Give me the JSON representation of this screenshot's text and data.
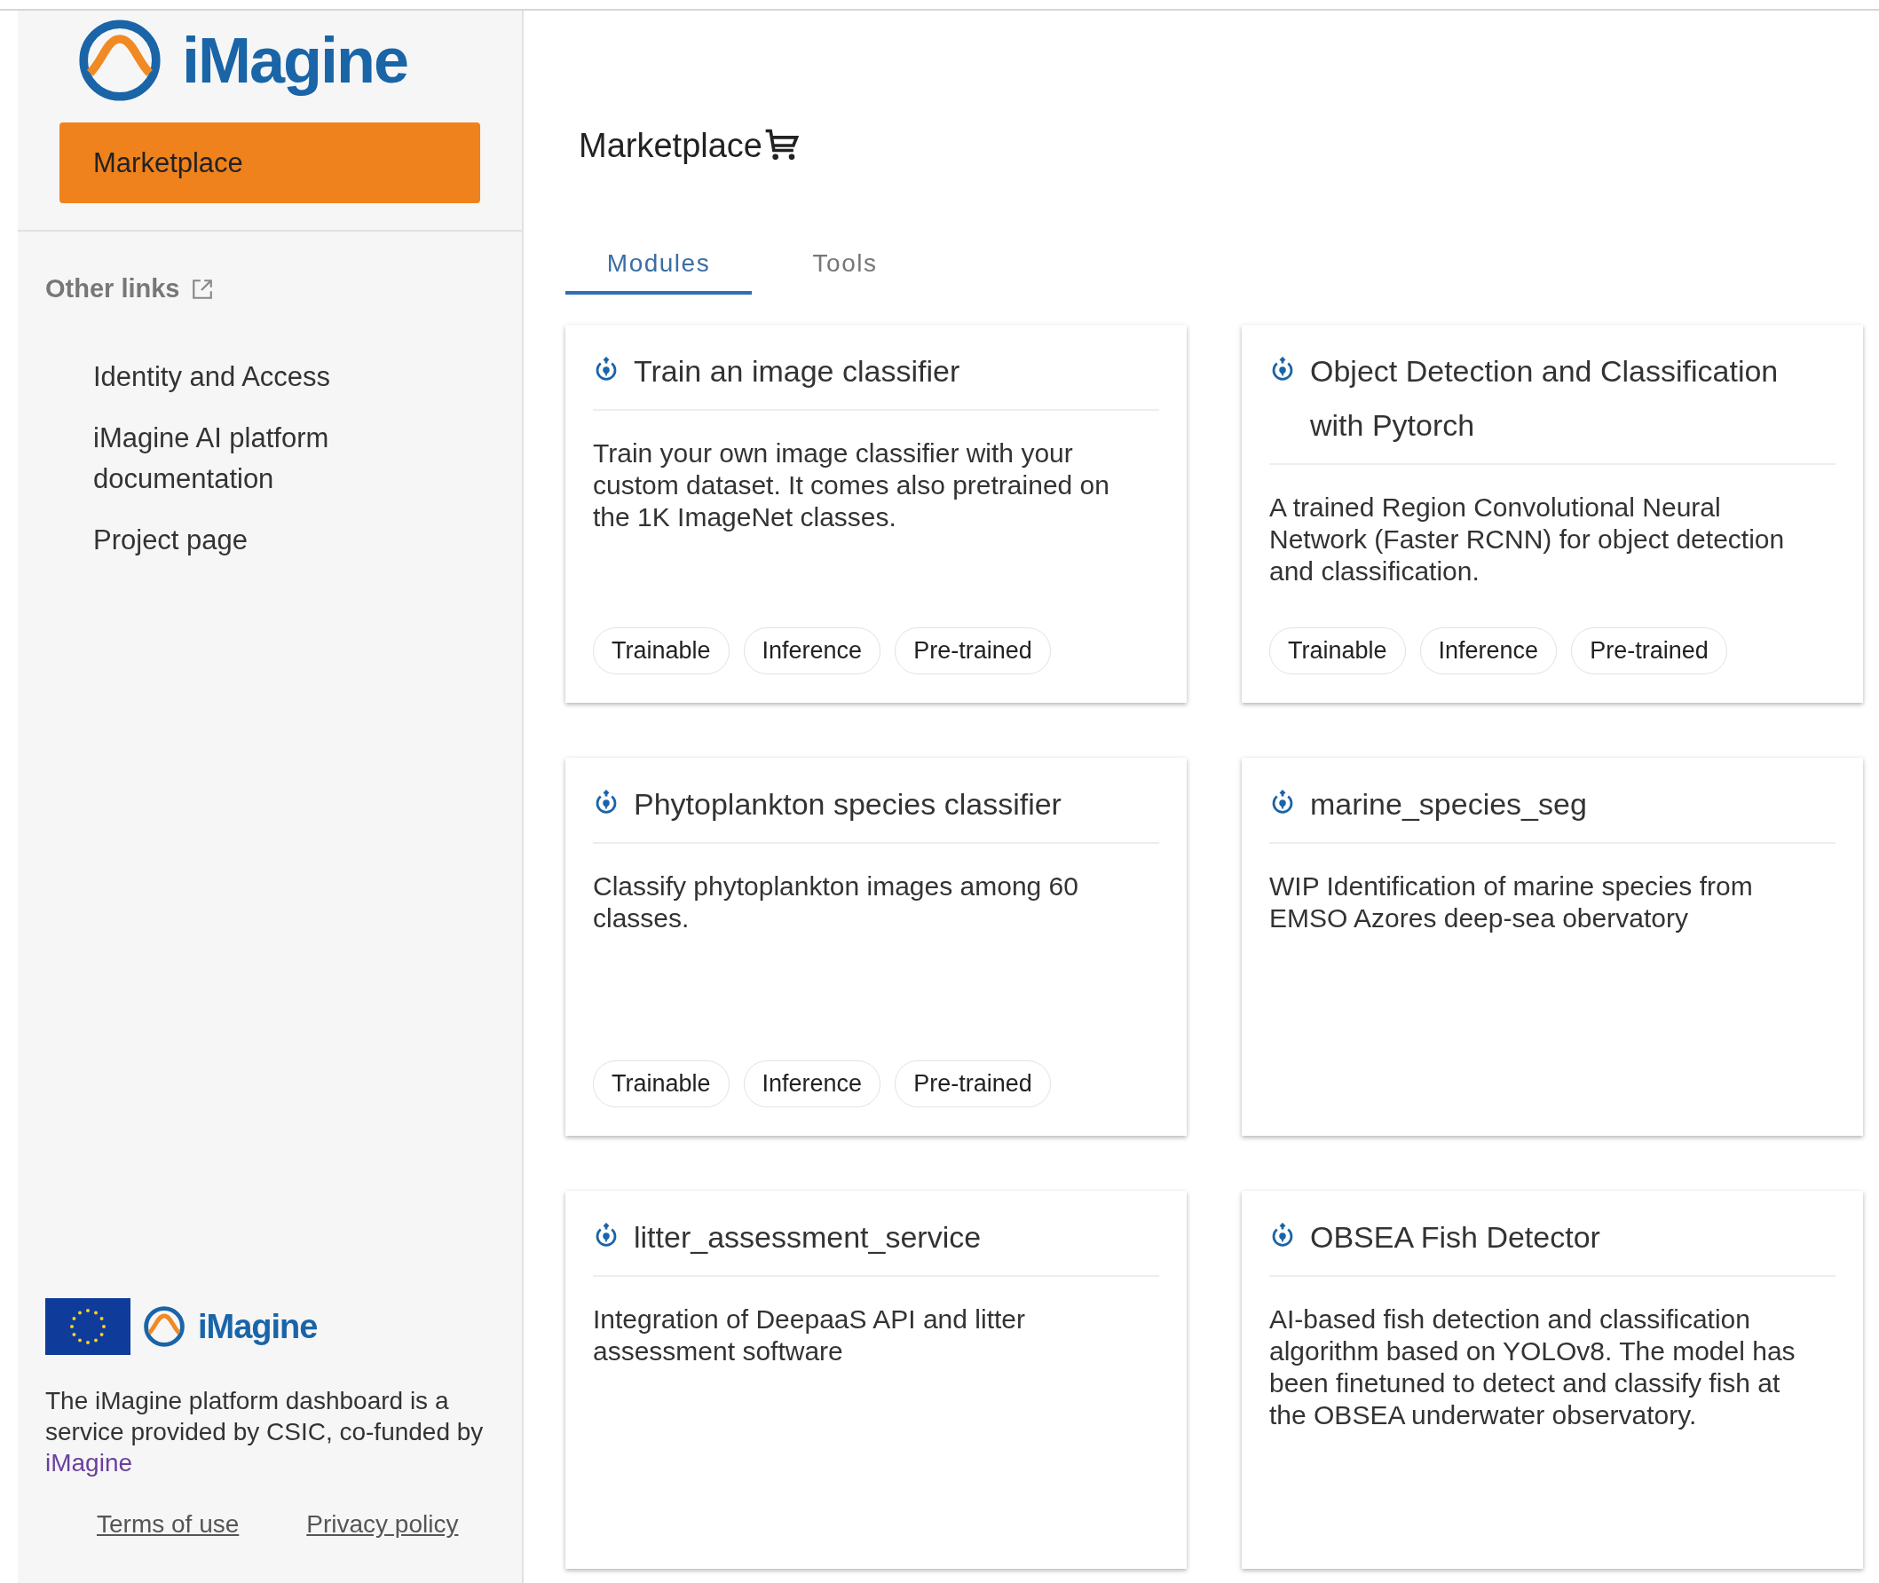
{
  "sidebar": {
    "logo": {
      "text": "iMagine"
    },
    "nav": [
      {
        "label": "Marketplace",
        "selected": true
      }
    ],
    "other_links": {
      "title": "Other links",
      "items": [
        "Identity and Access",
        "iMagine AI platform documentation",
        "Project page"
      ]
    },
    "footer": {
      "logo": {
        "text": "iMagine"
      },
      "text_before": "The iMagine platform dashboard is a service provided by CSIC, co-funded by",
      "link": "iMagine",
      "links": [
        "Terms of use",
        "Privacy policy"
      ]
    }
  },
  "main": {
    "title": "Marketplace",
    "tabs": [
      {
        "label": "Modules",
        "selected": true
      },
      {
        "label": "Tools",
        "selected": false
      }
    ],
    "cards": [
      {
        "title": "Train an image classifier",
        "description": "Train your own image classifier with your custom dataset. It comes also pretrained on the 1K ImageNet classes.",
        "tags": [
          "Trainable",
          "Inference",
          "Pre-trained"
        ]
      },
      {
        "title": "Object Detection and Classification with Pytorch",
        "description": "A trained Region Convolutional Neural Network (Faster RCNN) for object detection and classification.",
        "tags": [
          "Trainable",
          "Inference",
          "Pre-trained"
        ]
      },
      {
        "title": "Phytoplankton species classifier",
        "description": "Classify phytoplankton images among 60 classes.",
        "tags": [
          "Trainable",
          "Inference",
          "Pre-trained"
        ]
      },
      {
        "title": "marine_species_seg",
        "description": "WIP Identification of marine species from EMSO Azores deep-sea obervatory"
      },
      {
        "title": "litter_assessment_service",
        "description": "Integration of DeepaaS API and litter assessment software"
      },
      {
        "title": "OBSEA Fish Detector",
        "description": "AI-based fish detection and classification algorithm based on YOLOv8. The model has been finetuned to detect and classify fish at the OBSEA underwater observatory."
      }
    ]
  }
}
